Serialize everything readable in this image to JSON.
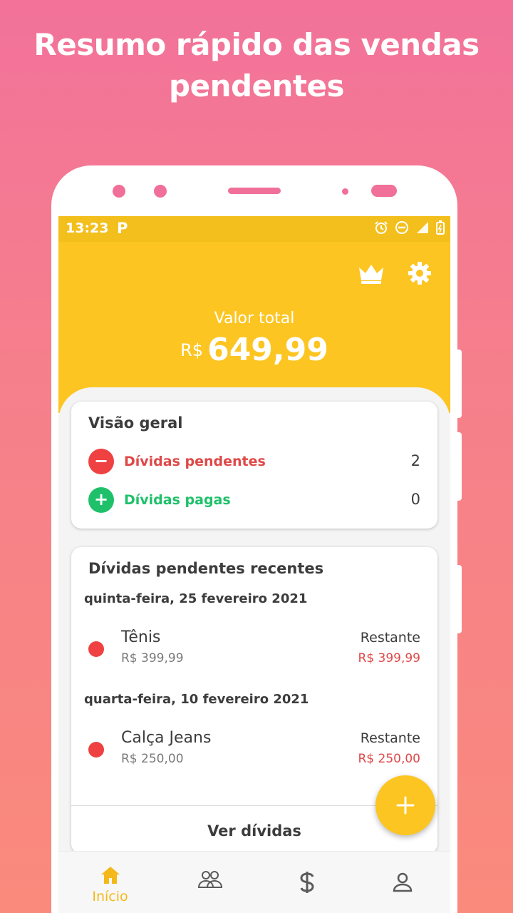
{
  "promo": {
    "headline_line1": "Resumo rápido das vendas",
    "headline_line2": "pendentes"
  },
  "status_bar": {
    "time": "13:23",
    "app_icon_letter": "P",
    "icons": [
      "alarm-icon",
      "do-not-disturb-icon",
      "signal-icon",
      "battery-icon"
    ]
  },
  "header": {
    "icons": [
      "crown-icon",
      "gear-icon"
    ],
    "total_label": "Valor total",
    "currency": "R$",
    "total_value": "649,99"
  },
  "overview": {
    "title": "Visão geral",
    "rows": [
      {
        "label": "Dívidas pendentes",
        "count": "2",
        "symbol": "−",
        "color": "#ef4141"
      },
      {
        "label": "Dívidas pagas",
        "count": "0",
        "symbol": "+",
        "color": "#1ec16a"
      }
    ]
  },
  "recent": {
    "title": "Dívidas pendentes recentes",
    "groups": [
      {
        "date": "quinta-feira, 25 fevereiro 2021",
        "item": {
          "name": "Tênis",
          "price": "R$ 399,99",
          "remaining_label": "Restante",
          "remaining": "R$ 399,99"
        }
      },
      {
        "date": "quarta-feira, 10 fevereiro 2021",
        "item": {
          "name": "Calça Jeans",
          "price": "R$ 250,00",
          "remaining_label": "Restante",
          "remaining": "R$ 250,00"
        }
      }
    ],
    "see_all": "Ver dívidas"
  },
  "fab": {
    "icon": "plus-icon"
  },
  "bottom_nav": {
    "items": [
      {
        "label": "Início",
        "icon": "home-icon",
        "active": true
      },
      {
        "label": "",
        "icon": "people-icon",
        "active": false
      },
      {
        "label": "",
        "icon": "dollar-icon",
        "active": false
      },
      {
        "label": "",
        "icon": "person-icon",
        "active": false
      }
    ]
  },
  "colors": {
    "accent_yellow": "#fcc522",
    "status_yellow": "#f3bf1d",
    "pending_red": "#ef4141",
    "paid_green": "#1ec16a",
    "nav_active": "#f5b81a",
    "nav_inactive": "#5a5a5a"
  }
}
